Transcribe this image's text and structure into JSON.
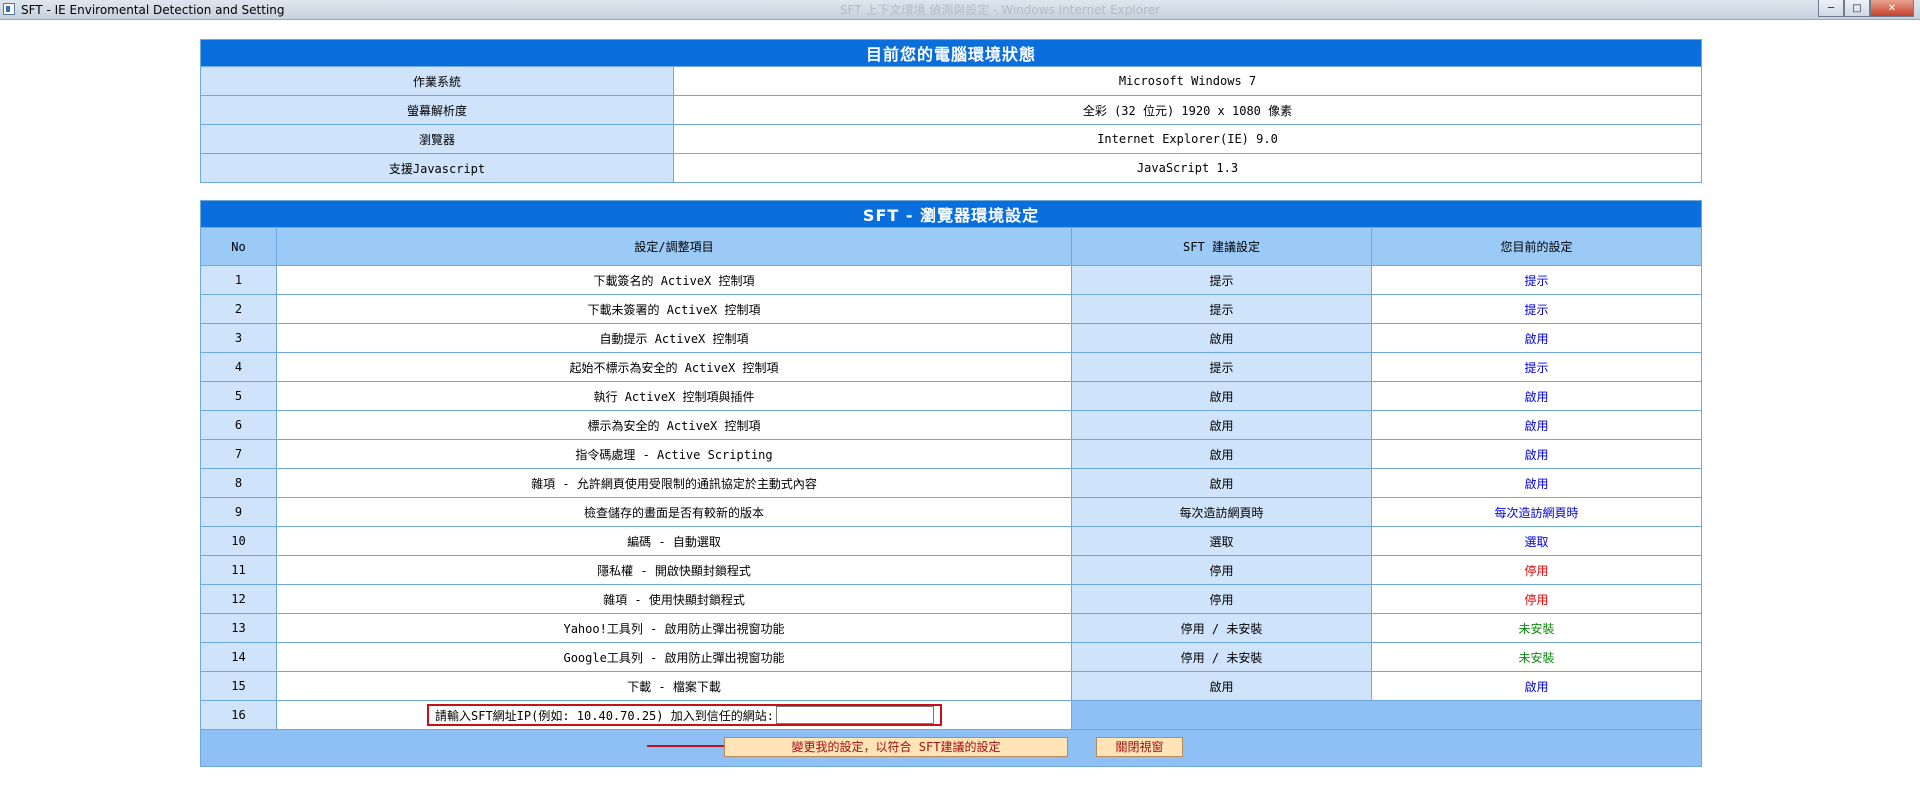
{
  "window": {
    "title": "SFT - IE Enviromental Detection and Setting",
    "faded_title": "SFT 上下文環境 偵測與設定 - Windows Internet Explorer",
    "minimize": "─",
    "maximize": "□",
    "close": "✕"
  },
  "env_panel": {
    "title": "目前您的電腦環境狀態",
    "rows": [
      {
        "label": "作業系統",
        "value": "Microsoft Windows 7"
      },
      {
        "label": "螢幕解析度",
        "value": "全彩 (32 位元) 1920 x 1080 像素"
      },
      {
        "label": "瀏覽器",
        "value": "Internet Explorer(IE) 9.0"
      },
      {
        "label": "支援Javascript",
        "value": "JavaScript 1.3"
      }
    ]
  },
  "settings_panel": {
    "title": "SFT - 瀏覽器環境設定",
    "columns": [
      "No",
      "設定/調整項目",
      "SFT 建議設定",
      "您目前的設定"
    ],
    "rows": [
      {
        "no": "1",
        "item": "下載簽名的 ActiveX 控制項",
        "sft": "提示",
        "current": "提示",
        "color": "blue"
      },
      {
        "no": "2",
        "item": "下載未簽署的 ActiveX 控制項",
        "sft": "提示",
        "current": "提示",
        "color": "blue"
      },
      {
        "no": "3",
        "item": "自動提示 ActiveX 控制項",
        "sft": "啟用",
        "current": "啟用",
        "color": "blue"
      },
      {
        "no": "4",
        "item": "起始不標示為安全的 ActiveX 控制項",
        "sft": "提示",
        "current": "提示",
        "color": "blue"
      },
      {
        "no": "5",
        "item": "執行 ActiveX 控制項與插件",
        "sft": "啟用",
        "current": "啟用",
        "color": "blue"
      },
      {
        "no": "6",
        "item": "標示為安全的 ActiveX 控制項",
        "sft": "啟用",
        "current": "啟用",
        "color": "blue"
      },
      {
        "no": "7",
        "item": "指令碼處理 - Active Scripting",
        "sft": "啟用",
        "current": "啟用",
        "color": "blue"
      },
      {
        "no": "8",
        "item": "雜項 - 允許網頁使用受限制的通訊協定於主動式內容",
        "sft": "啟用",
        "current": "啟用",
        "color": "blue"
      },
      {
        "no": "9",
        "item": "檢查儲存的畫面是否有較新的版本",
        "sft": "每次造訪網頁時",
        "current": "每次造訪網頁時",
        "color": "blue"
      },
      {
        "no": "10",
        "item": "編碼 - 自動選取",
        "sft": "選取",
        "current": "選取",
        "color": "blue"
      },
      {
        "no": "11",
        "item": "隱私權 - 開啟快顯封鎖程式",
        "sft": "停用",
        "current": "停用",
        "color": "red"
      },
      {
        "no": "12",
        "item": "雜項 - 使用快顯封鎖程式",
        "sft": "停用",
        "current": "停用",
        "color": "red"
      },
      {
        "no": "13",
        "item": "Yahoo!工具列 - 啟用防止彈出視窗功能",
        "sft": "停用 / 未安裝",
        "current": "未安裝",
        "color": "green"
      },
      {
        "no": "14",
        "item": "Google工具列 - 啟用防止彈出視窗功能",
        "sft": "停用 / 未安裝",
        "current": "未安裝",
        "color": "green"
      },
      {
        "no": "15",
        "item": "下載 - 檔案下載",
        "sft": "啟用",
        "current": "啟用",
        "color": "blue"
      }
    ],
    "ip_row": {
      "no": "16",
      "label": "請輸入SFT網址IP(例如: 10.40.70.25) 加入到信任的網站:",
      "value": "",
      "placeholder": ""
    },
    "apply_button": "變更我的設定，以符合 SFT建議的設定",
    "close_button": "關閉視窗"
  },
  "colors": {
    "header_bg": "#0a6fdc",
    "label_bg": "#cfe4fb",
    "column_header_bg": "#9ccaf7",
    "footer_bg": "#8ec0f5",
    "ok_blue": "#0000e6",
    "warn_red": "#e60000",
    "info_green": "#0f8a0f",
    "highlight_red": "#c8101c",
    "button_bg": "#ffe4b8"
  }
}
